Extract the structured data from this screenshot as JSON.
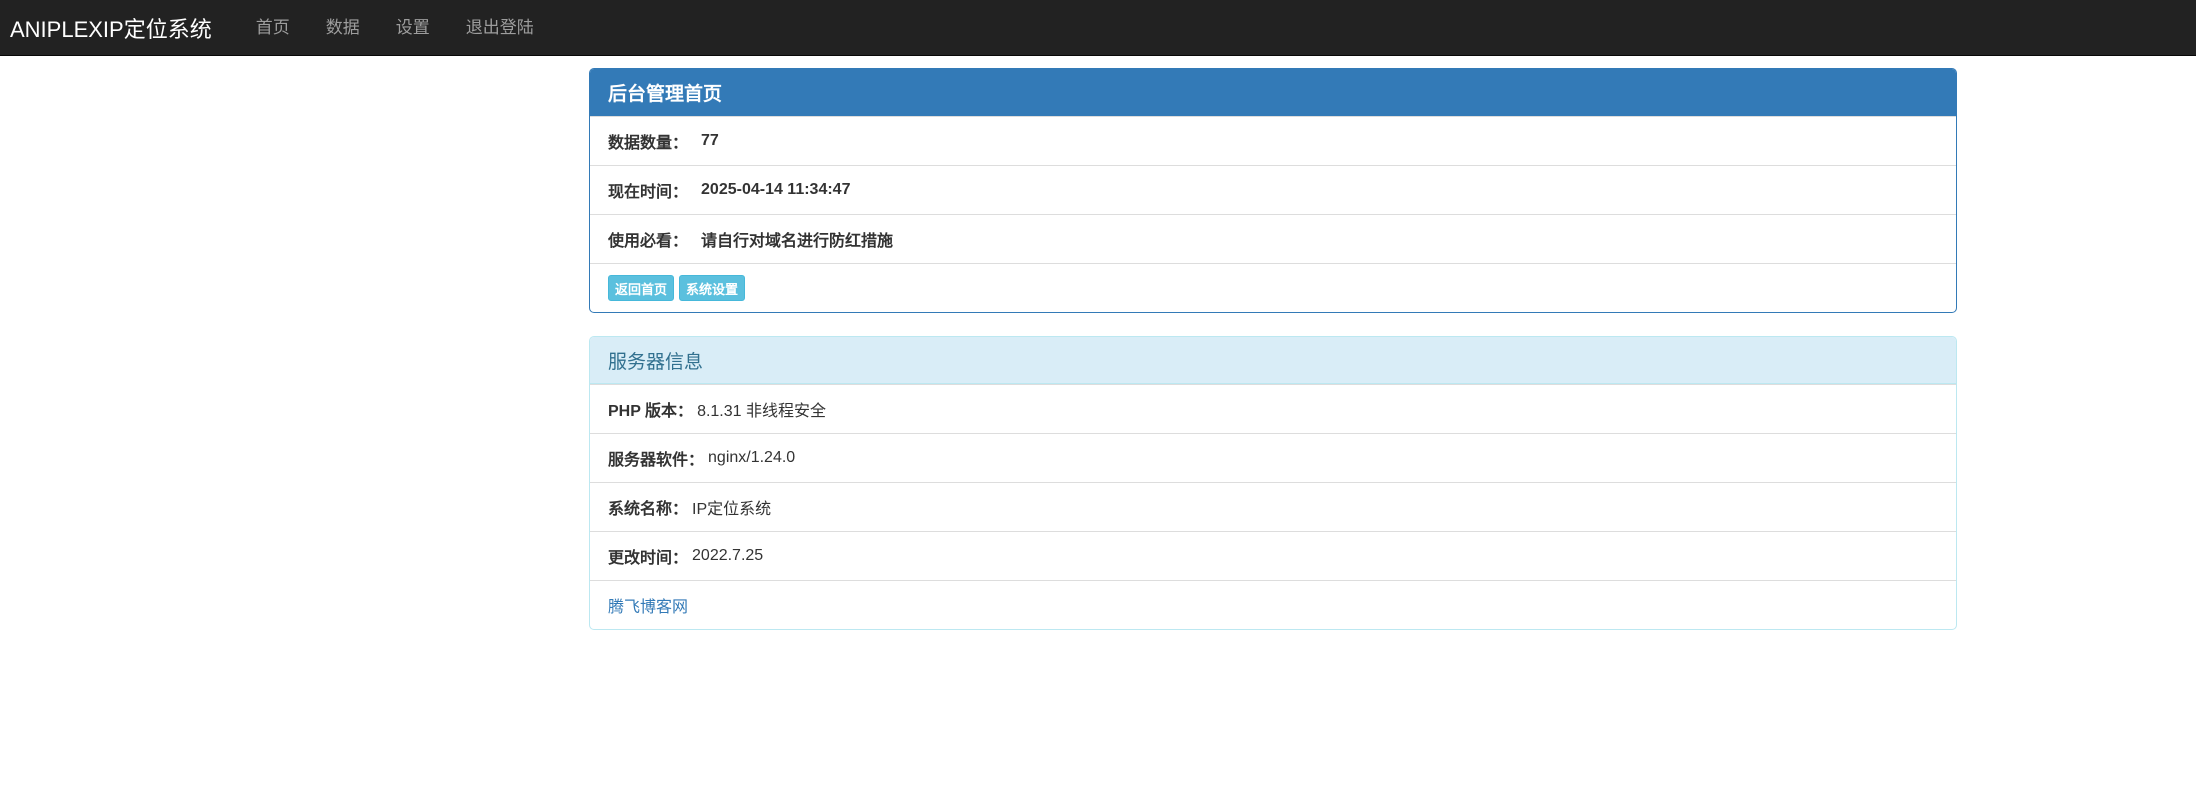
{
  "navbar": {
    "brand": "ANIPLEXIP定位系统",
    "items": [
      {
        "label": "首页"
      },
      {
        "label": "数据"
      },
      {
        "label": "设置"
      },
      {
        "label": "退出登陆"
      }
    ]
  },
  "admin_panel": {
    "title": "后台管理首页",
    "rows": [
      {
        "label": "数据数量：",
        "value": "77"
      },
      {
        "label": "现在时间：",
        "value": "2025-04-14 11:34:47"
      },
      {
        "label": "使用必看：",
        "value": "请自行对域名进行防红措施"
      }
    ],
    "buttons": {
      "back_home": "返回首页",
      "system_settings": "系统设置"
    }
  },
  "server_panel": {
    "title": "服务器信息",
    "rows": [
      {
        "label": "PHP 版本：",
        "value": "8.1.31 非线程安全"
      },
      {
        "label": "服务器软件：",
        "value": "nginx/1.24.0"
      },
      {
        "label": "系统名称：",
        "value": " IP定位系统"
      },
      {
        "label": "更改时间：",
        "value": "2022.7.25"
      }
    ],
    "link": "腾飞博客网"
  },
  "colors": {
    "navbar_bg": "#222222",
    "primary": "#337ab7",
    "info_bg": "#d9edf7",
    "info_text": "#31708f",
    "button_info": "#5bc0de"
  }
}
